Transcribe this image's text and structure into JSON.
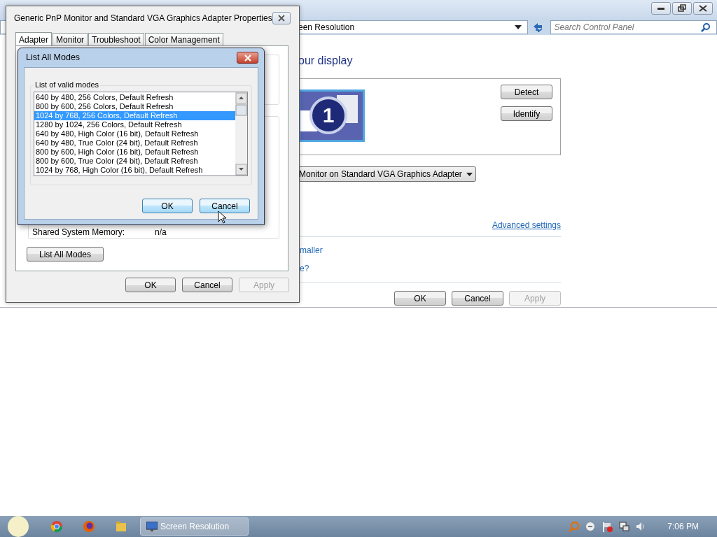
{
  "screen_resolution_window": {
    "address": "een Resolution",
    "search": {
      "placeholder": "Search Control Panel"
    },
    "heading": "our display",
    "display_number": "1",
    "display_buttons": [
      "Detect",
      "Identify"
    ],
    "display_select": "Monitor on Standard VGA Graphics Adapter",
    "advanced_link": "Advanced settings",
    "links": [
      "maller",
      "e?"
    ],
    "buttons": [
      {
        "label": "OK",
        "disabled": false
      },
      {
        "label": "Cancel",
        "disabled": false
      },
      {
        "label": "Apply",
        "disabled": true
      }
    ]
  },
  "properties_dialog": {
    "title": "Generic PnP Monitor and Standard VGA Graphics Adapter Properties",
    "tabs": [
      {
        "label": "Adapter",
        "selected": true
      },
      {
        "label": "Monitor",
        "selected": false
      },
      {
        "label": "Troubleshoot",
        "selected": false
      },
      {
        "label": "Color Management",
        "selected": false
      }
    ],
    "info": [
      {
        "label": "Shared System Memory:",
        "value": "n/a"
      }
    ],
    "list_modes_button": "List All Modes",
    "buttons": [
      {
        "label": "OK",
        "disabled": false
      },
      {
        "label": "Cancel",
        "disabled": false
      },
      {
        "label": "Apply",
        "disabled": true
      }
    ]
  },
  "modes_dialog": {
    "title": "List All Modes",
    "group_label": "List of valid modes",
    "modes": [
      {
        "text": "640 by 480, 256 Colors, Default Refresh",
        "selected": false
      },
      {
        "text": "800 by 600, 256 Colors, Default Refresh",
        "selected": false
      },
      {
        "text": "1024 by 768, 256 Colors, Default Refresh",
        "selected": true
      },
      {
        "text": "1280 by 1024, 256 Colors, Default Refresh",
        "selected": false
      },
      {
        "text": "640 by 480, High Color (16 bit), Default Refresh",
        "selected": false
      },
      {
        "text": "640 by 480, True Color (24 bit), Default Refresh",
        "selected": false
      },
      {
        "text": "800 by 600, High Color (16 bit), Default Refresh",
        "selected": false
      },
      {
        "text": "800 by 600, True Color (24 bit), Default Refresh",
        "selected": false
      },
      {
        "text": "1024 by 768, High Color (16 bit), Default Refresh",
        "selected": false
      }
    ],
    "buttons": [
      "OK",
      "Cancel"
    ]
  },
  "taskbar": {
    "window_button": {
      "label": "Screen Resolution",
      "active": true
    },
    "clock": "7:06 PM"
  }
}
